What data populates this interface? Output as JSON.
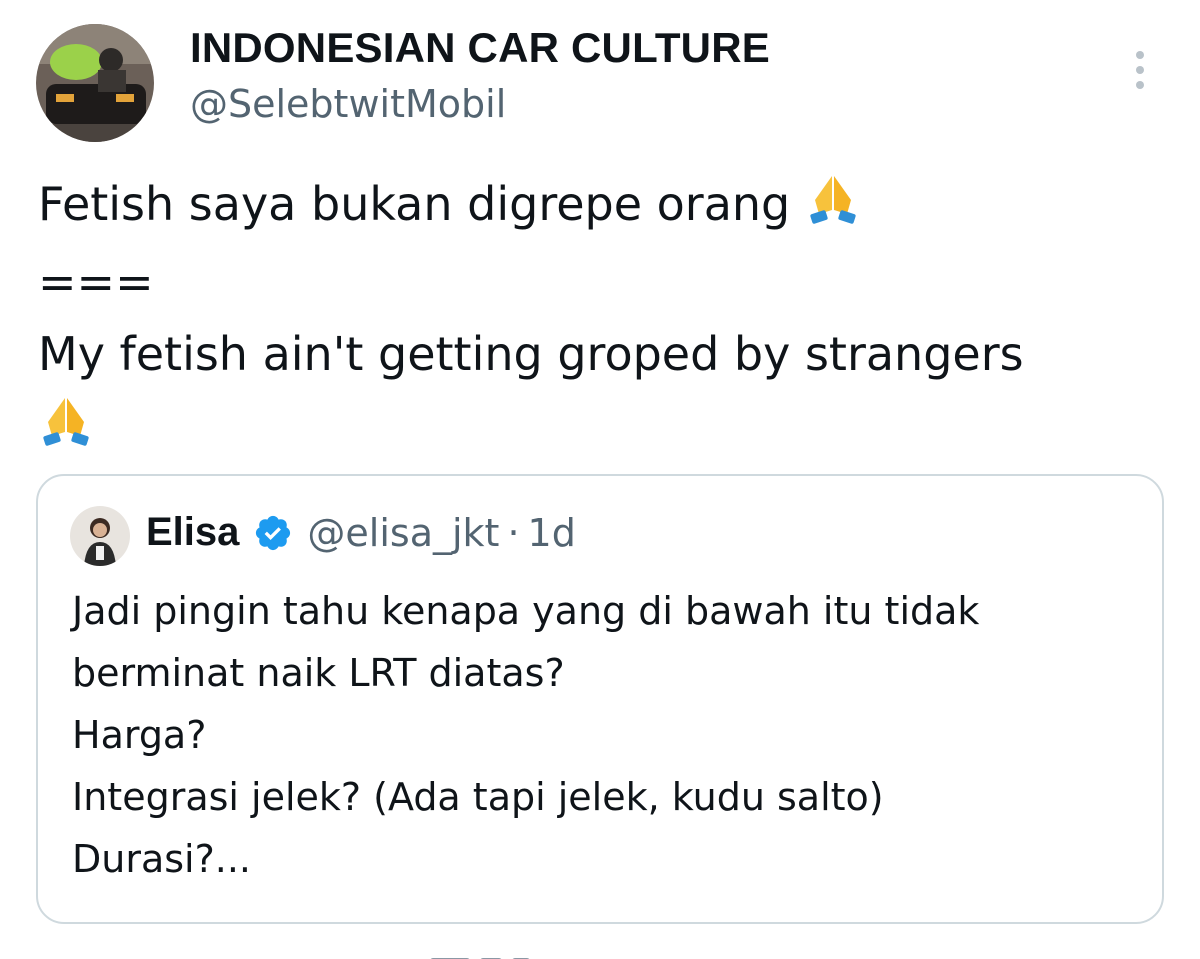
{
  "tweet": {
    "author_name": "INDONESIAN CAR CULTURE",
    "author_handle": "@SelebtwitMobil",
    "lines": [
      "Fetish saya bukan digrepe orang",
      "===",
      "My fetish ain't getting groped by strangers"
    ],
    "emoji": "pray-emoji"
  },
  "quoted_tweet": {
    "author_name": "Elisa",
    "verified": true,
    "author_handle": "@elisa_jkt",
    "separator": "·",
    "time": "1d",
    "lines": [
      "Jadi pingin tahu kenapa yang di bawah itu tidak",
      "berminat naik LRT diatas?",
      "Harga?",
      "Integrasi jelek? (Ada tapi jelek, kudu salto)",
      "Durasi?..."
    ]
  },
  "colors": {
    "text": "#0f1419",
    "secondary_text": "#536471",
    "border": "#cfd9de",
    "verified_blue": "#1d9bf0"
  }
}
